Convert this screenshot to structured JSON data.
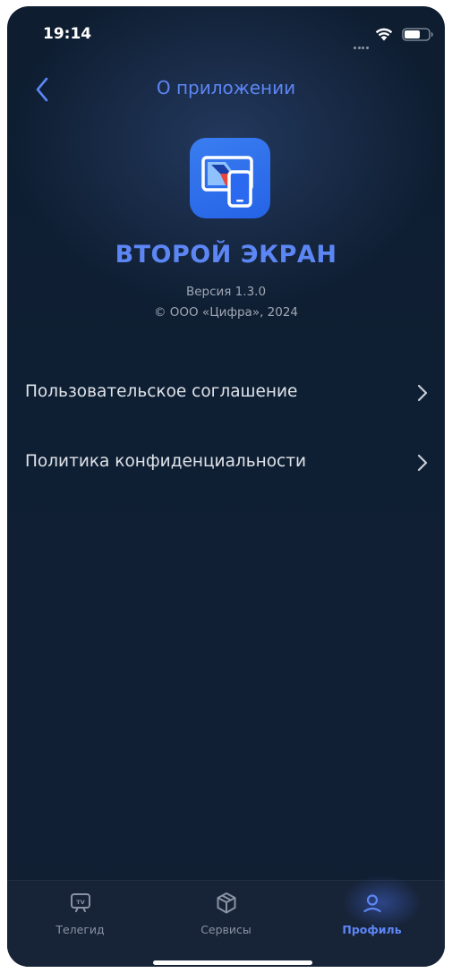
{
  "status_bar": {
    "time": "19:14"
  },
  "header": {
    "title": "О приложении",
    "back_icon": "chevron-left-icon"
  },
  "app": {
    "icon": "screens-app-icon",
    "name": "ВТОРОЙ ЭКРАН",
    "version": "Версия 1.3.0",
    "copyright": "© ООО «Цифра», 2024"
  },
  "menu": [
    {
      "label": "Пользовательское соглашение",
      "icon": "chevron-right-icon"
    },
    {
      "label": "Политика конфиденциальности",
      "icon": "chevron-right-icon"
    }
  ],
  "tab_bar": {
    "tabs": [
      {
        "label": "Телегид",
        "icon": "tv-icon",
        "active": false
      },
      {
        "label": "Сервисы",
        "icon": "box-icon",
        "active": false
      },
      {
        "label": "Профиль",
        "icon": "profile-icon",
        "active": true
      }
    ]
  },
  "colors": {
    "accent": "#5d86f5",
    "background": "#0f1f33",
    "text_primary": "#dfe3ea",
    "text_secondary": "#a0a7b5",
    "tab_inactive": "#8a93a4",
    "app_icon_bg": "#2563e6"
  }
}
